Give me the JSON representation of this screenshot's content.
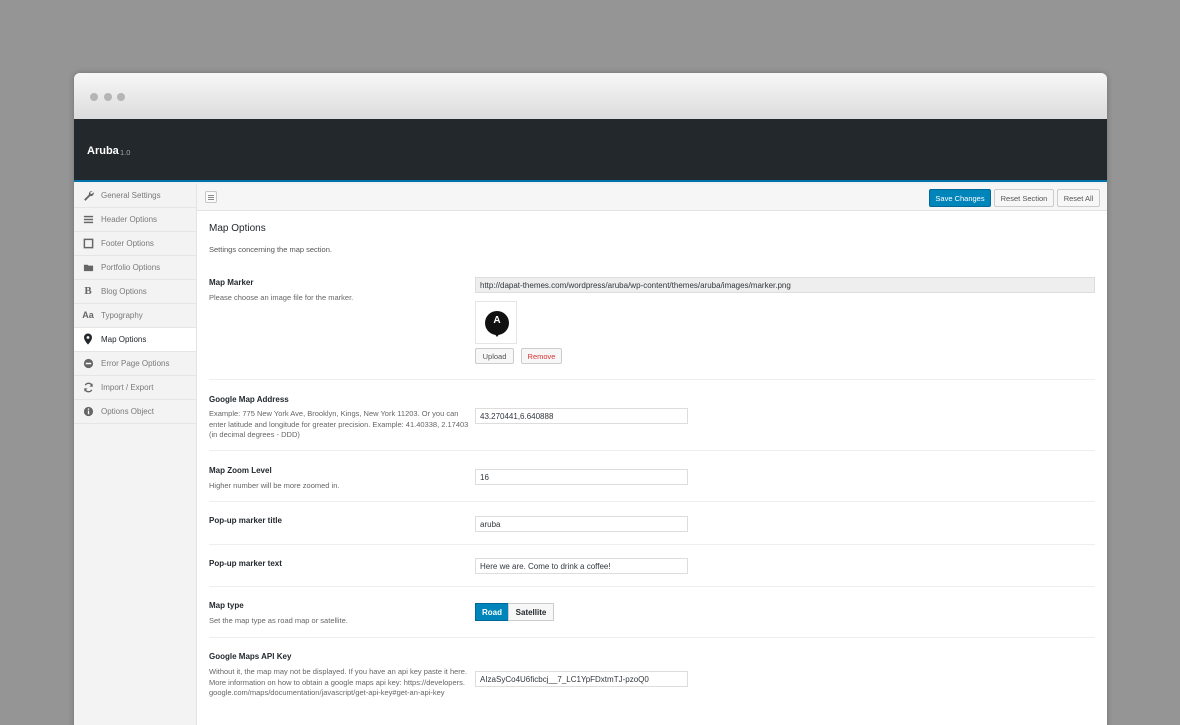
{
  "app": {
    "title": "Aruba",
    "version": "1.0"
  },
  "sidebar": {
    "items": [
      {
        "label": "General Settings",
        "icon": "wrench-icon",
        "active": false
      },
      {
        "label": "Header Options",
        "icon": "menu-icon",
        "active": false
      },
      {
        "label": "Footer Options",
        "icon": "square-icon",
        "active": false
      },
      {
        "label": "Portfolio Options",
        "icon": "folder-icon",
        "active": false
      },
      {
        "label": "Blog Options",
        "icon": "blog-icon",
        "active": false
      },
      {
        "label": "Typography",
        "icon": "typography-icon",
        "active": false
      },
      {
        "label": "Map Options",
        "icon": "location-pin-icon",
        "active": true
      },
      {
        "label": "Error Page Options",
        "icon": "no-entry-icon",
        "active": false
      },
      {
        "label": "Import / Export",
        "icon": "refresh-icon",
        "active": false
      },
      {
        "label": "Options Object",
        "icon": "info-icon",
        "active": false
      }
    ]
  },
  "toolbar": {
    "save_label": "Save Changes",
    "reset_section_label": "Reset Section",
    "reset_all_label": "Reset All"
  },
  "section": {
    "title": "Map Options",
    "description": "Settings concerning the map section."
  },
  "fields": {
    "map_marker": {
      "label": "Map Marker",
      "description": "Please choose an image file for the marker.",
      "value": "http://dapat-themes.com/wordpress/aruba/wp-content/themes/aruba/images/marker.png",
      "preview_letter": "A",
      "upload_label": "Upload",
      "remove_label": "Remove"
    },
    "address": {
      "label": "Google Map Address",
      "description": "Example: 775 New York Ave, Brooklyn, Kings, New York 11203. Or you can enter latitude and longitude for greater precision. Example: 41.40338, 2.17403 (in decimal degrees - DDD)",
      "value": "43.270441,6.640888"
    },
    "zoom": {
      "label": "Map Zoom Level",
      "description": "Higher number will be more zoomed in.",
      "value": "16"
    },
    "popup_title": {
      "label": "Pop-up marker title",
      "value": "aruba"
    },
    "popup_text": {
      "label": "Pop-up marker text",
      "value": "Here we are. Come to drink a coffee!"
    },
    "map_type": {
      "label": "Map type",
      "description": "Set the map type as road map or satellite.",
      "options": [
        "Road",
        "Satellite"
      ],
      "selected": "Road"
    },
    "api_key": {
      "label": "Google Maps API Key",
      "description": "Without it, the map may not be displayed. If you have an api key paste it here. More information on how to obtain a google maps api key: https://developers.google.com/maps/documentation/javascript/get-api-key#get-an-api-key",
      "value": "AIzaSyCo4U6ficbcj__7_LC1YpFDxtmTJ-pzoQ0"
    }
  },
  "colors": {
    "header_bg": "#23282d",
    "accent": "#0085ba",
    "danger": "#dc3232"
  }
}
